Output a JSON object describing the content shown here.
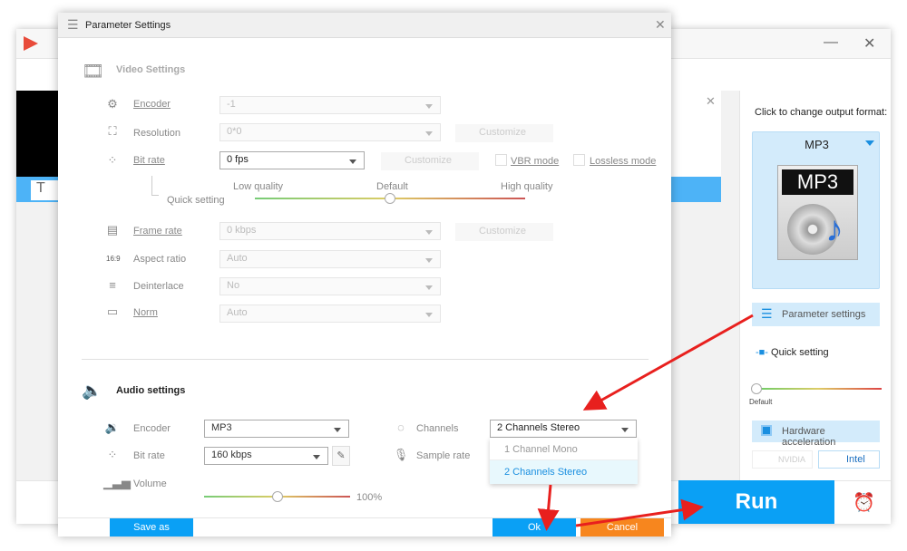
{
  "background_window": {
    "status_tab_icon": "text-T-icon",
    "minimize_icon": "minimize-icon",
    "close_icon": "close-icon",
    "output_panel": {
      "prompt": "Click to change output format:",
      "format": "MP3",
      "format_art_label": "MP3",
      "parameter_settings": "Parameter settings",
      "quick_setting": "Quick setting",
      "quick_setting_value": 0,
      "quick_setting_default": "Default",
      "hardware_acceleration": "Hardware acceleration",
      "nvidia": "NVIDIA",
      "intel": "Intel"
    },
    "run_label": "Run",
    "accent": "#0aa0f5"
  },
  "dialog": {
    "title": "Parameter Settings",
    "video": {
      "heading": "Video Settings",
      "encoder": {
        "label": "Encoder",
        "value": "-1"
      },
      "resolution": {
        "label": "Resolution",
        "value": "0*0",
        "customize": "Customize"
      },
      "bit_rate": {
        "label": "Bit rate",
        "value": "0 fps",
        "customize": "Customize",
        "vbr": "VBR mode",
        "lossless": "Lossless mode"
      },
      "quick_setting": {
        "label": "Quick setting",
        "low": "Low quality",
        "default": "Default",
        "high": "High quality",
        "value": 0.5
      },
      "frame_rate": {
        "label": "Frame rate",
        "value": "0 kbps",
        "customize": "Customize"
      },
      "aspect_ratio": {
        "label": "Aspect ratio",
        "value": "Auto",
        "icon_text": "16:9"
      },
      "deinterlace": {
        "label": "Deinterlace",
        "value": "No"
      },
      "norm": {
        "label": "Norm",
        "value": "Auto"
      }
    },
    "audio": {
      "heading": "Audio settings",
      "encoder": {
        "label": "Encoder",
        "value": "MP3"
      },
      "bit_rate": {
        "label": "Bit rate",
        "value": "160 kbps"
      },
      "volume": {
        "label": "Volume",
        "value": "100%",
        "level": 0.5
      },
      "channels": {
        "label": "Channels",
        "value": "2 Channels Stereo",
        "options": [
          "1 Channel Mono",
          "2 Channels Stereo"
        ]
      },
      "sample_rate": {
        "label": "Sample rate"
      }
    },
    "save_as": "Save as",
    "ok": "Ok",
    "cancel": "Cancel",
    "colors": {
      "blue": "#0aa0f5",
      "orange": "#f7861e"
    }
  }
}
